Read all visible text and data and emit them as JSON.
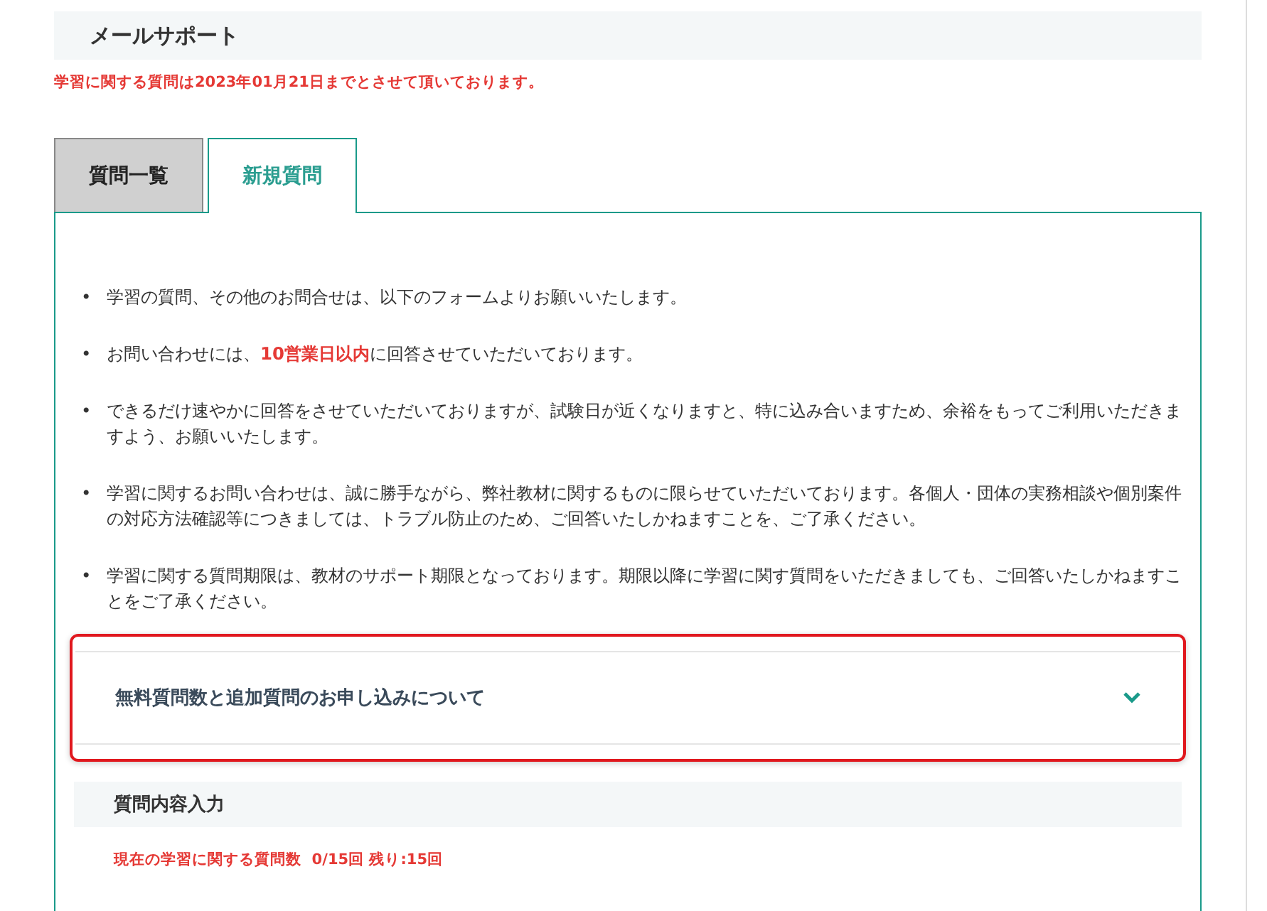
{
  "header": {
    "title": "メールサポート"
  },
  "notice": "学習に関する質問は2023年01月21日までとさせて頂いております。",
  "tabs": [
    {
      "label": "質問一覧",
      "selected": false
    },
    {
      "label": "新規質問",
      "selected": true
    }
  ],
  "notes": [
    {
      "bullet": "•",
      "text": "学習の質問、その他のお問合せは、以下のフォームよりお願いいたします。"
    },
    {
      "bullet": "•",
      "text": "お問い合わせには、**10営業日以内**に回答させていただいております。"
    },
    {
      "bullet": "•",
      "text": "できるだけ速やかに回答をさせていただいておりますが、試験日が近くなりますと、特に込み合いますため、余裕をもってご利用いただきますよう、お願いいたします。"
    },
    {
      "bullet": "•",
      "text": "学習に関するお問い合わせは、誠に勝手ながら、弊社教材に関するものに限らせていただいております。各個人・団体の実務相談や個別案件の対応方法確認等につきましては、トラブル防止のため、ご回答いたしかねますことを、ご了承ください。"
    },
    {
      "bullet": "•",
      "text": "学習に関する質問期限は、教材のサポート期限となっております。期限以降に学習に関す質問をいただきましても、ご回答いたしかねますことをご了承ください。"
    }
  ],
  "accordion": {
    "title": "無料質問数と追加質問のお申し込みについて",
    "expanded": false,
    "highlighted": true
  },
  "section": {
    "title": "質問内容入力",
    "counter": "現在の学習に関する質問数  0/15回 残り:15回"
  }
}
